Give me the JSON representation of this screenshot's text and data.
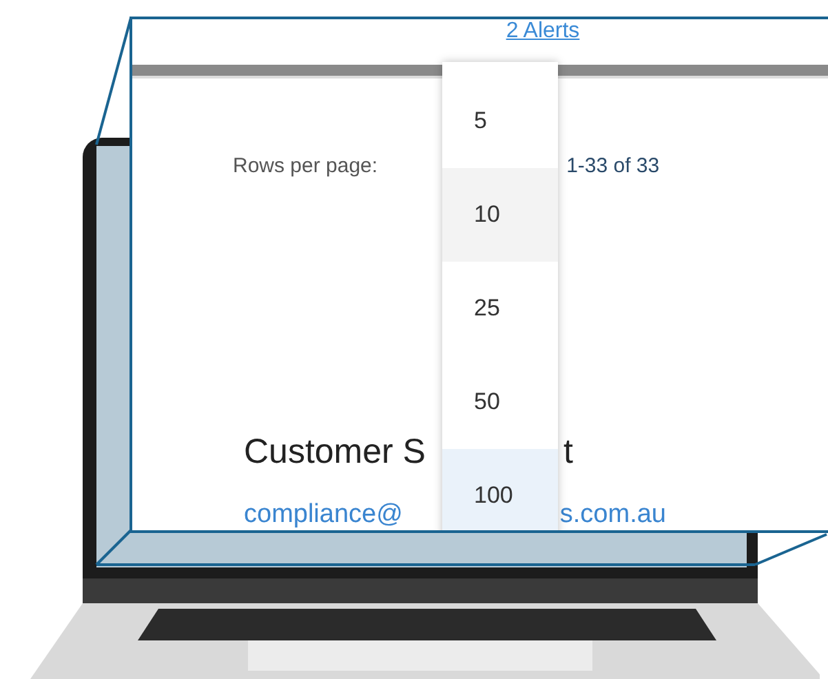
{
  "alerts_link": "2 Alerts",
  "pagination": {
    "rows_per_page_label": "Rows per page:",
    "range": "1-33 of 33"
  },
  "rows_per_page_menu": [
    {
      "label": "5",
      "highlighted": false,
      "selected": false
    },
    {
      "label": "10",
      "highlighted": true,
      "selected": false
    },
    {
      "label": "25",
      "highlighted": false,
      "selected": false
    },
    {
      "label": "50",
      "highlighted": false,
      "selected": false
    },
    {
      "label": "100",
      "highlighted": false,
      "selected": true
    }
  ],
  "footer": {
    "heading_parts": [
      "Customer S",
      "t"
    ],
    "email_parts": [
      "compliance@",
      "s.com.au"
    ]
  }
}
